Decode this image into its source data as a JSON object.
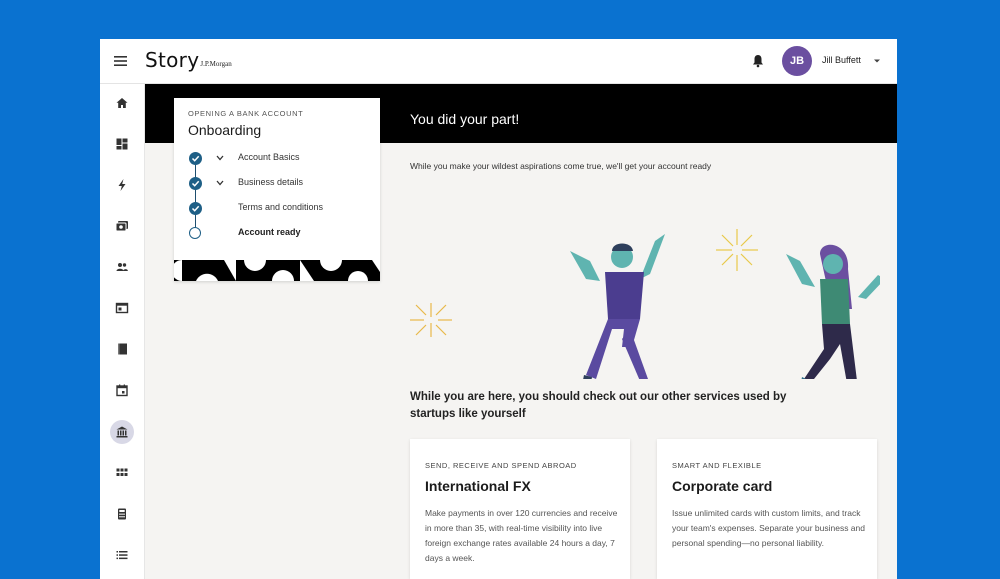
{
  "brand": {
    "name": "Story",
    "sub": "J.P.Morgan"
  },
  "user": {
    "initials": "JB",
    "name": "Jill Buffett",
    "avatar_color": "#6b4fa0"
  },
  "sidebar": {
    "items": [
      {
        "icon": "home-icon"
      },
      {
        "icon": "dashboard-icon"
      },
      {
        "icon": "lightning-icon"
      },
      {
        "icon": "payments-icon"
      },
      {
        "icon": "people-icon"
      },
      {
        "icon": "browser-icon"
      },
      {
        "icon": "book-icon"
      },
      {
        "icon": "calendar-icon"
      },
      {
        "icon": "bank-icon",
        "active": true
      },
      {
        "icon": "grid-icon"
      },
      {
        "icon": "calculator-icon"
      },
      {
        "icon": "list-icon"
      }
    ]
  },
  "onboarding": {
    "eyebrow": "OPENING A BANK ACCOUNT",
    "title": "Onboarding",
    "steps": [
      {
        "label": "Account Basics",
        "done": true,
        "expandable": true
      },
      {
        "label": "Business details",
        "done": true,
        "expandable": true
      },
      {
        "label": "Terms and conditions",
        "done": true,
        "expandable": false
      },
      {
        "label": "Account ready",
        "done": false,
        "expandable": false,
        "current": true
      }
    ]
  },
  "banner": {
    "title": "You did your part!"
  },
  "intro": "While you make your wildest aspirations come true, we'll get your account ready",
  "services": {
    "heading": "While you are here, you should check out our other services used by startups like yourself",
    "cards": [
      {
        "eyebrow": "SEND, RECEIVE AND SPEND ABROAD",
        "title": "International FX",
        "desc": "Make payments in over 120 currencies and receive in more than 35, with real-time visibility into live foreign exchange rates available 24 hours a day, 7 days a week."
      },
      {
        "eyebrow": "SMART AND FLEXIBLE",
        "title": "Corporate card",
        "desc": "Issue unlimited cards with custom limits, and track your team's expenses. Separate your business and personal spending—no personal liability."
      }
    ]
  },
  "colors": {
    "background": "#0a72d0",
    "banner": "#000000",
    "step_accent": "#1e5f86",
    "figure_man_shirt": "#4b3d8f",
    "figure_woman_top": "#3e8a74",
    "skin": "#5fb4b0"
  }
}
